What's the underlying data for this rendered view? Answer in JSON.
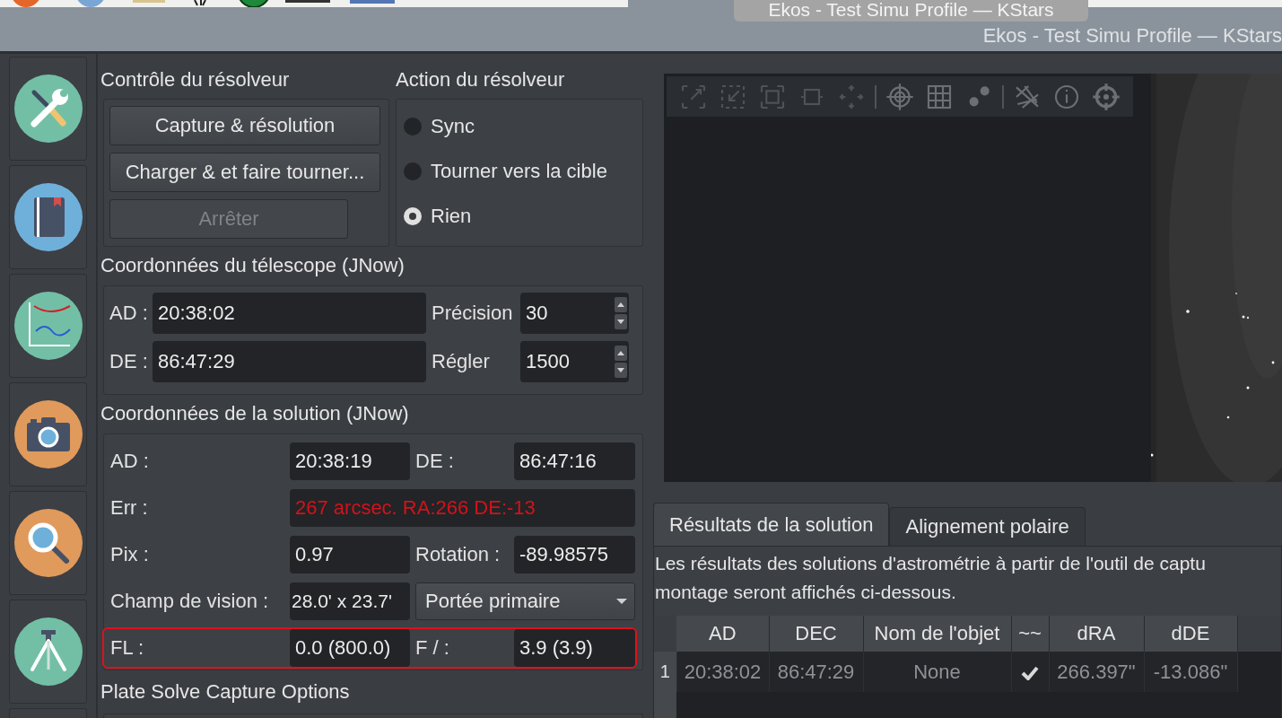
{
  "window": {
    "tooltip": "Ekos - Test Simu Profile — KStars",
    "title": "Ekos - Test Simu Profile — KStars"
  },
  "module_tabs": [
    {
      "kind": "tools"
    },
    {
      "kind": "book"
    },
    {
      "kind": "chart"
    },
    {
      "kind": "camera"
    },
    {
      "kind": "search"
    },
    {
      "kind": "tripod"
    },
    {
      "kind": "partial"
    }
  ],
  "solver_control": {
    "title": "Contrôle du résolveur",
    "buttons": [
      {
        "label": "Capture & résolution",
        "disabled": false
      },
      {
        "label": "Charger & et faire tourner...",
        "disabled": false
      },
      {
        "label": "Arrêter",
        "disabled": true
      }
    ]
  },
  "solver_action": {
    "title": "Action du résolveur",
    "options": [
      {
        "label": "Sync",
        "selected": false
      },
      {
        "label": "Tourner vers la cible",
        "selected": false
      },
      {
        "label": "Rien",
        "selected": true
      }
    ]
  },
  "telescope": {
    "title": "Coordonnées du télescope (JNow)",
    "rows": [
      {
        "label": "AD :",
        "value": "20:38:02",
        "spin_label": "Précision",
        "spin_value": "30"
      },
      {
        "label": "DE :",
        "value": "86:47:29",
        "spin_label": "Régler",
        "spin_value": "1500"
      }
    ]
  },
  "solution": {
    "title": "Coordonnées de la solution (JNow)",
    "rows": [
      {
        "kind": "pair",
        "highlighted": false,
        "cells": [
          {
            "label": "AD :",
            "value": "20:38:19"
          },
          {
            "label": "DE :",
            "value": "86:47:16"
          }
        ]
      },
      {
        "kind": "wide",
        "highlighted": false,
        "error": true,
        "label": "Err :",
        "value": "267 arcsec. RA:266 DE:-13"
      },
      {
        "kind": "pair",
        "highlighted": false,
        "cells": [
          {
            "label": "Pix :",
            "value": "0.97"
          },
          {
            "label": "Rotation :",
            "value": "-89.98575"
          }
        ]
      },
      {
        "kind": "dropdown",
        "highlighted": false,
        "label": "Champ de vision :",
        "value": "28.0' x 23.7'",
        "dropdown": "Portée primaire"
      },
      {
        "kind": "pair",
        "highlighted": true,
        "cells": [
          {
            "label": "FL :",
            "value": "0.0 (800.0)"
          },
          {
            "label": "F /  :",
            "value": "3.9 (3.9)"
          }
        ]
      }
    ]
  },
  "capture_options": {
    "title": "Plate Solve Capture Options"
  },
  "viewer": {
    "toolbar_groups": [
      {
        "tools": [
          {
            "kind": "expand",
            "disabled": true
          },
          {
            "kind": "shrink",
            "disabled": true
          },
          {
            "kind": "frame",
            "disabled": true
          },
          {
            "kind": "square",
            "disabled": true
          },
          {
            "kind": "move",
            "disabled": true
          }
        ]
      },
      {
        "tools": [
          {
            "kind": "crosshair",
            "disabled": false
          },
          {
            "kind": "grid",
            "disabled": false
          },
          {
            "kind": "stars",
            "disabled": false
          }
        ]
      },
      {
        "tools": [
          {
            "kind": "lines",
            "disabled": false
          },
          {
            "kind": "info",
            "disabled": false
          },
          {
            "kind": "target",
            "disabled": false
          }
        ]
      }
    ]
  },
  "results": {
    "tabs": [
      {
        "label": "Résultats de la solution",
        "selected": true
      },
      {
        "label": "Alignement polaire",
        "selected": false
      }
    ],
    "description": [
      "Les résultats des solutions d'astrométrie à partir de l'outil de captu",
      "montage seront affichés ci-dessous."
    ],
    "table": {
      "columns": [
        "AD",
        "DEC",
        "Nom de l'objet",
        "~~",
        "dRA",
        "dDE"
      ],
      "rows": [
        {
          "index": "1",
          "ad": "20:38:02",
          "dec": "86:47:29",
          "name": "None",
          "solved": true,
          "dra": "266.397\"",
          "dde": "-13.086\""
        }
      ]
    }
  }
}
